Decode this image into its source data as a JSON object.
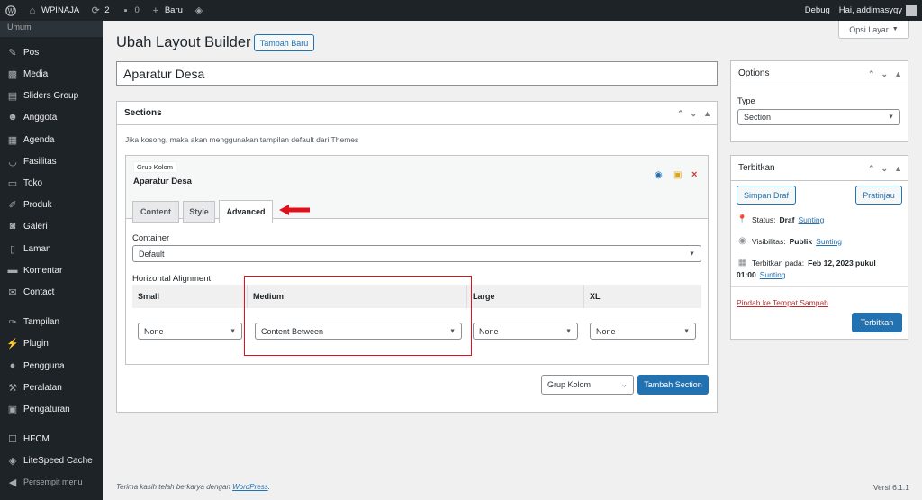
{
  "adminbar": {
    "site_name": "WPINAJA",
    "updates_count": "2",
    "comments_count": "0",
    "new_label": "Baru",
    "debug_label": "Debug",
    "greeting": "Hai, addimasyqy"
  },
  "sidebar": {
    "top_label": "Umum",
    "items": [
      {
        "label": "Pos",
        "icon": "pin-icon"
      },
      {
        "label": "Media",
        "icon": "media-icon"
      },
      {
        "label": "Sliders Group",
        "icon": "slides-icon"
      },
      {
        "label": "Anggota",
        "icon": "people-icon"
      },
      {
        "label": "Agenda",
        "icon": "calendar-icon"
      },
      {
        "label": "Fasilitas",
        "icon": "smile-icon"
      },
      {
        "label": "Toko",
        "icon": "store-icon"
      },
      {
        "label": "Produk",
        "icon": "brush-icon"
      },
      {
        "label": "Galeri",
        "icon": "camera-icon"
      },
      {
        "label": "Laman",
        "icon": "page-icon"
      },
      {
        "label": "Komentar",
        "icon": "comment-icon"
      },
      {
        "label": "Contact",
        "icon": "mail-icon"
      },
      {
        "label": "Tampilan",
        "icon": "appearance-icon"
      },
      {
        "label": "Plugin",
        "icon": "plugin-icon"
      },
      {
        "label": "Pengguna",
        "icon": "user-icon"
      },
      {
        "label": "Peralatan",
        "icon": "tools-icon"
      },
      {
        "label": "Pengaturan",
        "icon": "settings-icon"
      },
      {
        "label": "HFCM",
        "icon": "robot-icon"
      },
      {
        "label": "LiteSpeed Cache",
        "icon": "diamond-icon"
      },
      {
        "label": "Persempit menu",
        "icon": "collapse-icon"
      }
    ]
  },
  "header": {
    "title": "Ubah Layout Builder",
    "add_new": "Tambah Baru",
    "screen_options": "Opsi Layar"
  },
  "post_title": "Aparatur Desa",
  "sections": {
    "title": "Sections",
    "note": "Jika kosong, maka akan menggunakan tampilan default dari Themes",
    "group_tag": "Grup Kolom",
    "section_name": "Aparatur Desa",
    "tabs": [
      "Content",
      "Style",
      "Advanced"
    ],
    "container_label": "Container",
    "container_value": "Default",
    "halign_label": "Horizontal Alignment",
    "columns": [
      "Small",
      "Medium",
      "Large",
      "XL"
    ],
    "values": [
      "None",
      "Content Between",
      "None",
      "None"
    ],
    "group_select": "Grup Kolom",
    "add_section": "Tambah Section"
  },
  "options": {
    "title": "Options",
    "type_label": "Type",
    "type_value": "Section"
  },
  "publish": {
    "title": "Terbitkan",
    "save_draft": "Simpan Draf",
    "preview": "Pratinjau",
    "status_label": "Status:",
    "status_value": "Draf",
    "visibility_label": "Visibilitas:",
    "visibility_value": "Publik",
    "edit_link": "Sunting",
    "publish_on_label": "Terbitkan pada:",
    "publish_on_value": "Feb 12, 2023 pukul",
    "publish_time": "01:00",
    "trash": "Pindah ke Tempat Sampah",
    "publish_btn": "Terbitkan"
  },
  "footer": {
    "thanks_prefix": "Terima kasih telah berkarya dengan",
    "wordpress_link": "WordPress",
    "version": "Versi 6.1.1"
  },
  "colors": {
    "accent": "#2271b1",
    "adminbar_bg": "#1d2327",
    "highlight": "#e0111b"
  }
}
